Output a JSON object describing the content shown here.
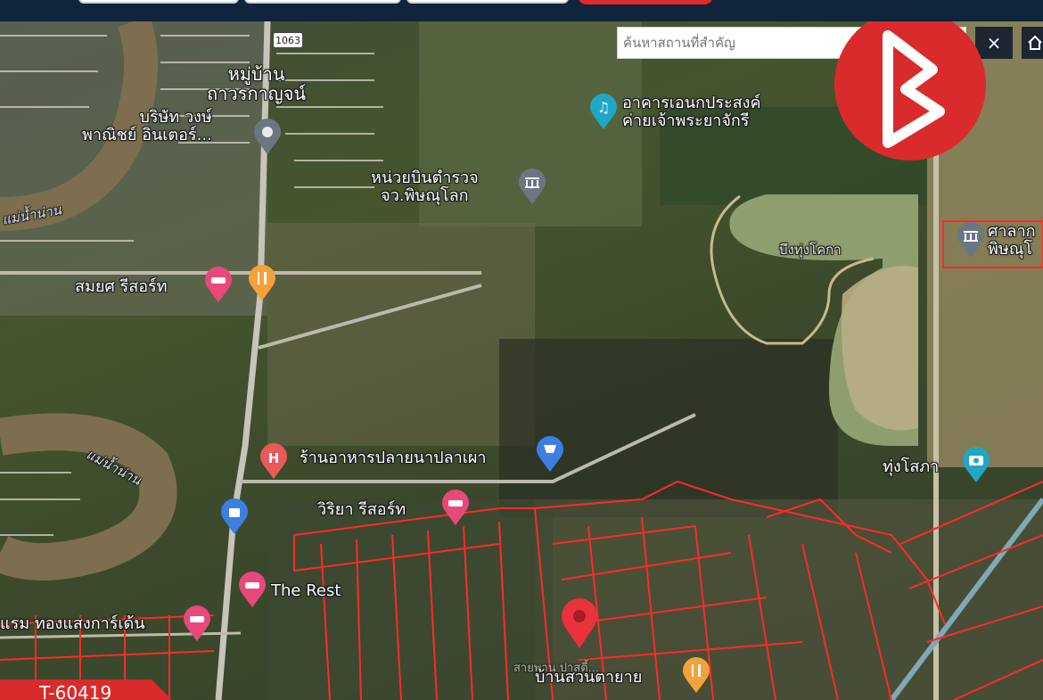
{
  "search": {
    "placeholder": "ค้นหาสถานที่สำคัญ"
  },
  "controls": {
    "close_label": "×"
  },
  "road_shield": "1063",
  "labels": {
    "village": "หมู่บ้าน\nถาวรกาญจน์",
    "company": "บริษัท วงษ์\nพาณิชย์ อินเตอร์...",
    "river_top": "แม่น้ำน่าน",
    "river_bottom": "แม่น้ำน่าน",
    "police_air": "หน่วยบินตำรวจ\nจว.พิษณุโลก",
    "hall": "อาคารเอนกประสงค์\nค่ายเจ้าพระยาจักรี",
    "lake": "บึงทุ่งโคกา",
    "court": "ศาลาก\nพิษณุโ",
    "resort1": "สมยศ รีสอร์ท",
    "restaurant": "ร้านอาหารปลายนาปลาเผา",
    "resort2": "วิริยา รีสอร์ท",
    "rest": "The Rest",
    "hotel": "แรม ทองแสงการ์เด้น",
    "thung_sotha": "ทุ่งโสภา",
    "ban_suan": "บ้านสวนตายาย",
    "faint": "สายพาน ปาสตี้..."
  },
  "listing_id": "T-60419",
  "colors": {
    "toolbar": "#10243c",
    "parcel_lines": "#ff2a2a",
    "pin_red": "#e8323c",
    "pin_pink": "#e8487a",
    "pin_orange": "#f2a23a",
    "pin_blue": "#3c7fe0",
    "pin_teal": "#1fa7c4",
    "pin_gray": "#6c7682",
    "logo": "#d92b2b"
  },
  "icons": [
    "music-icon",
    "museum-icon",
    "restaurant-icon",
    "hotel-icon",
    "hospital-icon",
    "shopping-icon",
    "camera-icon",
    "location-icon",
    "home-icon",
    "close-icon"
  ]
}
